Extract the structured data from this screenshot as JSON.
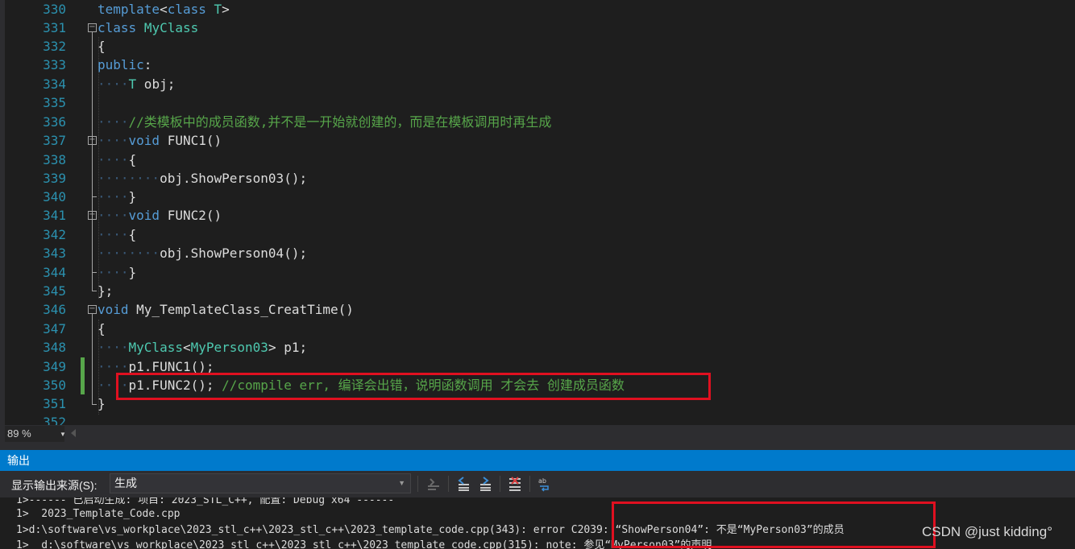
{
  "editor": {
    "lines": [
      {
        "num": "330",
        "text": "template<class T>"
      },
      {
        "num": "331",
        "text": "class MyClass"
      },
      {
        "num": "332",
        "text": "{"
      },
      {
        "num": "333",
        "text": "public:"
      },
      {
        "num": "334",
        "text": "T obj;"
      },
      {
        "num": "335",
        "text": ""
      },
      {
        "num": "336",
        "text": "//类模板中的成员函数,并不是一开始就创建的，而是在模板调用时再生成"
      },
      {
        "num": "337",
        "text": "void FUNC1()"
      },
      {
        "num": "338",
        "text": "{"
      },
      {
        "num": "339",
        "text": "obj.ShowPerson03();"
      },
      {
        "num": "340",
        "text": "}"
      },
      {
        "num": "341",
        "text": "void FUNC2()"
      },
      {
        "num": "342",
        "text": "{"
      },
      {
        "num": "343",
        "text": "obj.ShowPerson04();"
      },
      {
        "num": "344",
        "text": "}"
      },
      {
        "num": "345",
        "text": "};"
      },
      {
        "num": "346",
        "text": "void My_TemplateClass_CreatTime()"
      },
      {
        "num": "347",
        "text": "{"
      },
      {
        "num": "348",
        "text": "MyClass<MyPerson03> p1;"
      },
      {
        "num": "349",
        "text": "p1.FUNC1();"
      },
      {
        "num": "350",
        "text": "p1.FUNC2(); //compile err, 编译会出错，说明函数调用 才会去 创建成员函数"
      },
      {
        "num": "351",
        "text": "}"
      },
      {
        "num": "352",
        "text": ""
      }
    ],
    "tokens": {
      "template_kw": "template",
      "lt": "<",
      "class_kw": "class",
      "T": "T",
      "gt": ">",
      "MyClass": "MyClass",
      "lbrace": "{",
      "public_kw": "public",
      "colon": ":",
      "obj_decl": " obj;",
      "comment336": "//类模板中的成员函数,并不是一开始就创建的，而是在模板调用时再生成",
      "void_kw": "void",
      "func1": " FUNC1()",
      "call03": "obj.ShowPerson03();",
      "rbrace": "}",
      "func2": " FUNC2()",
      "call04": "obj.ShowPerson04();",
      "end_class": "};",
      "fn_name": " My_TemplateClass_CreatTime()",
      "MyPerson03": "MyPerson03",
      "p1_decl": " p1;",
      "call_f1": "p1.FUNC1();",
      "call_f2": "p1.FUNC2(); ",
      "comment350": "//compile err, 编译会出错，说明函数调用 才会去 创建成员函数",
      "ws_dots": "····",
      "ws_dots8": "········"
    }
  },
  "zoom": {
    "value": "89 %"
  },
  "output": {
    "title": "输出",
    "source_label": "显示输出来源(S):",
    "source_value": "生成",
    "lines": [
      "1>------ 已启动生成: 项目: 2023_STL_C++, 配置: Debug x64 ------",
      "1>  2023_Template_Code.cpp",
      "1>d:\\software\\vs_workplace\\2023_stl_c++\\2023_stl_c++\\2023_template_code.cpp(343): error C2039: “ShowPerson04”: 不是“MyPerson03”的成员",
      "1>  d:\\software\\vs_workplace\\2023_stl_c++\\2023_stl_c++\\2023_template_code.cpp(315): note: 参见“MyPerson03”的声明"
    ]
  },
  "watermark": "CSDN @just kidding°",
  "colors": {
    "keyword": "#569cd6",
    "type": "#4ec9b0",
    "comment": "#57a64a",
    "accent": "#007acc",
    "highlight": "#e01020"
  },
  "toolbar_icons": [
    "find-message-icon",
    "prev-message-icon",
    "next-message-icon",
    "clear-all-icon",
    "word-wrap-icon"
  ]
}
